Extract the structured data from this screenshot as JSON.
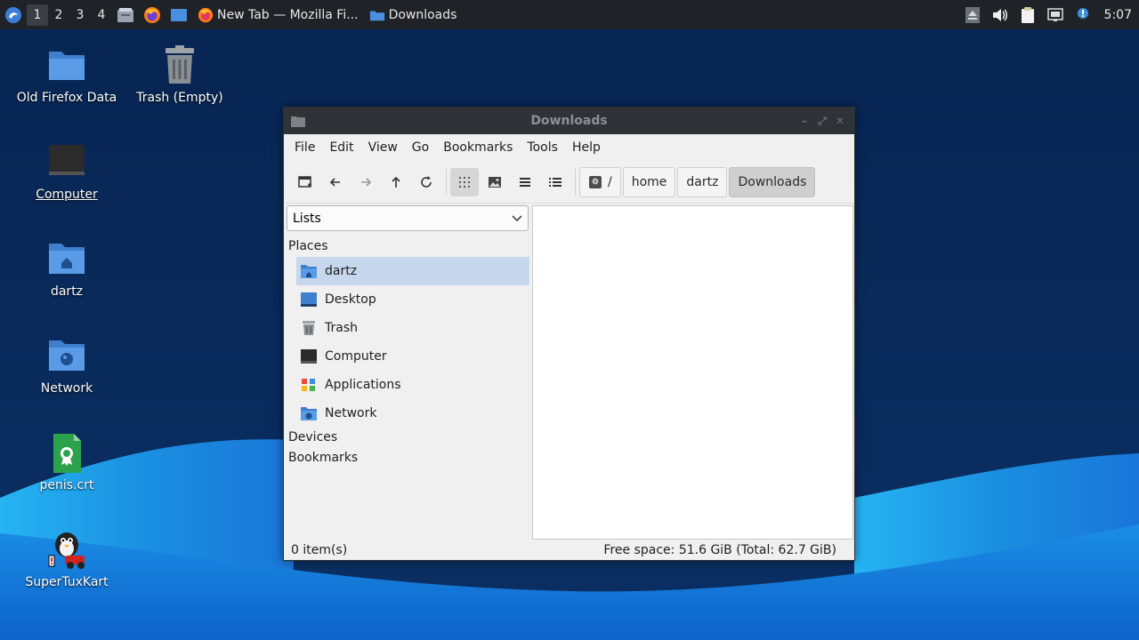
{
  "panel": {
    "workspaces": [
      "1",
      "2",
      "3",
      "4"
    ],
    "active_workspace": "1",
    "tasks": [
      {
        "label": "New Tab — Mozilla Fi...",
        "icon": "firefox-icon"
      },
      {
        "label": "Downloads",
        "icon": "folder-icon"
      }
    ],
    "clock": "5:07"
  },
  "desktop": {
    "icons": [
      {
        "label": "Old Firefox Data",
        "icon": "folder-icon"
      },
      {
        "label": "Trash (Empty)",
        "icon": "trash-icon"
      },
      {
        "label": "Computer",
        "icon": "computer-icon"
      },
      {
        "label": "dartz",
        "icon": "home-folder-icon"
      },
      {
        "label": "Network",
        "icon": "network-folder-icon"
      },
      {
        "label": "penis.crt",
        "icon": "certificate-icon"
      },
      {
        "label": "SuperTuxKart",
        "icon": "supertuxkart-icon"
      }
    ]
  },
  "window": {
    "title": "Downloads",
    "menu": [
      "File",
      "Edit",
      "View",
      "Go",
      "Bookmarks",
      "Tools",
      "Help"
    ],
    "breadcrumb": [
      "/",
      "home",
      "dartz",
      "Downloads"
    ],
    "sidebar": {
      "combo_value": "Lists",
      "sections": [
        "Places",
        "Devices",
        "Bookmarks"
      ],
      "places": [
        "dartz",
        "Desktop",
        "Trash",
        "Computer",
        "Applications",
        "Network"
      ],
      "selected_place": "dartz"
    },
    "status": {
      "items": "0 item(s)",
      "free_space": "Free space: 51.6 GiB (Total: 62.7 GiB)"
    }
  },
  "colors": {
    "panel_bg": "#1f2327",
    "desktop_dark": "#0b2a55",
    "wave_light": "#1fa3ec",
    "selection": "#c7d8ee",
    "folder_blue": "#4a90e2"
  }
}
